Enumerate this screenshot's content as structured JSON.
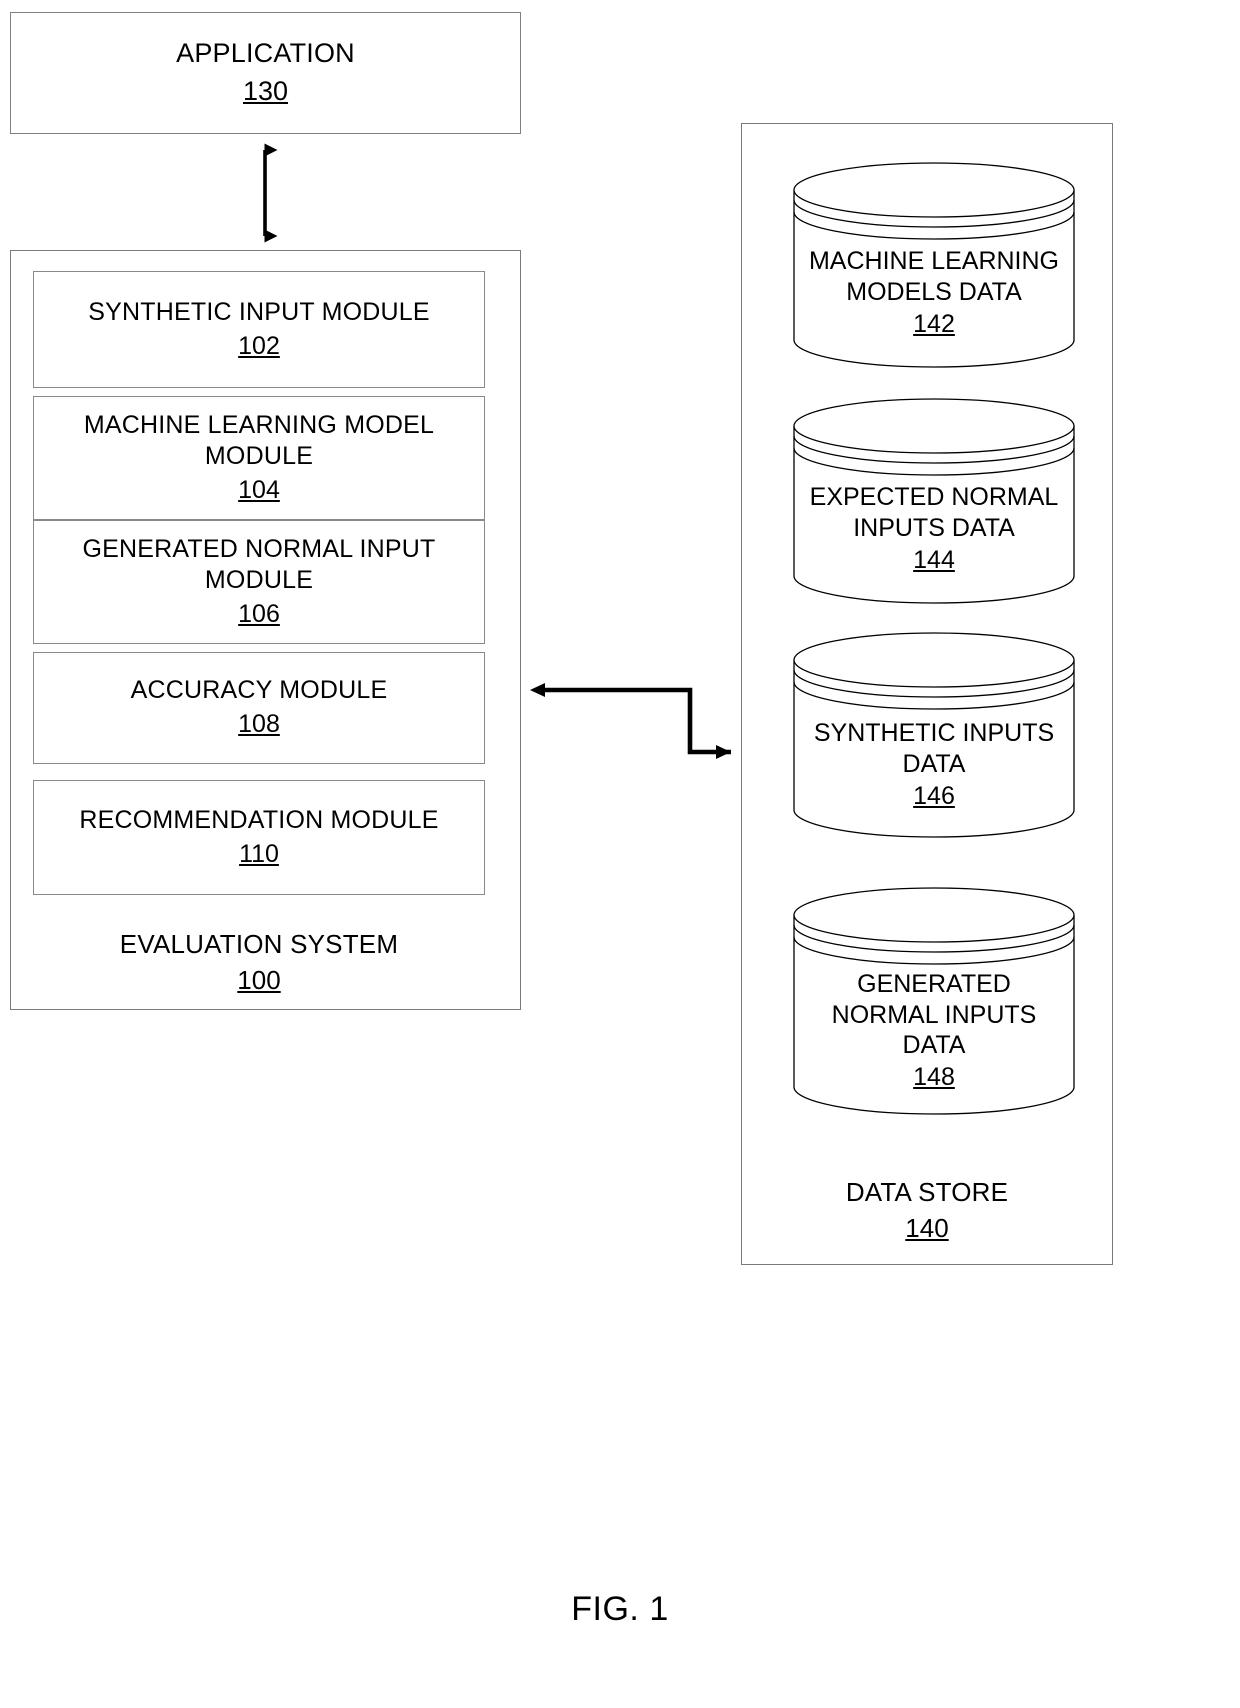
{
  "figure": {
    "caption": "FIG. 1"
  },
  "application": {
    "title": "APPLICATION",
    "ref": "130"
  },
  "evaluation_system": {
    "title": "EVALUATION SYSTEM",
    "ref": "100",
    "modules": [
      {
        "title": "SYNTHETIC INPUT MODULE",
        "ref": "102"
      },
      {
        "title": "MACHINE LEARNING MODEL\nMODULE",
        "ref": "104"
      },
      {
        "title": "GENERATED NORMAL INPUT\nMODULE",
        "ref": "106"
      },
      {
        "title": "ACCURACY MODULE",
        "ref": "108"
      },
      {
        "title": "RECOMMENDATION MODULE",
        "ref": "110"
      }
    ]
  },
  "data_store": {
    "title": "DATA STORE",
    "ref": "140",
    "stores": [
      {
        "title": "MACHINE LEARNING\nMODELS DATA",
        "ref": "142"
      },
      {
        "title": "EXPECTED NORMAL\nINPUTS DATA",
        "ref": "144"
      },
      {
        "title": "SYNTHETIC INPUTS\nDATA",
        "ref": "146"
      },
      {
        "title": "GENERATED\nNORMAL INPUTS\nDATA",
        "ref": "148"
      }
    ]
  },
  "connectors": {
    "application_to_evaluation": "bidirectional-vertical-arrow",
    "evaluation_to_datastore": "bidirectional-elbow-arrow"
  },
  "colors": {
    "stroke": "#000000",
    "box_border": "#808080",
    "background": "#ffffff"
  }
}
